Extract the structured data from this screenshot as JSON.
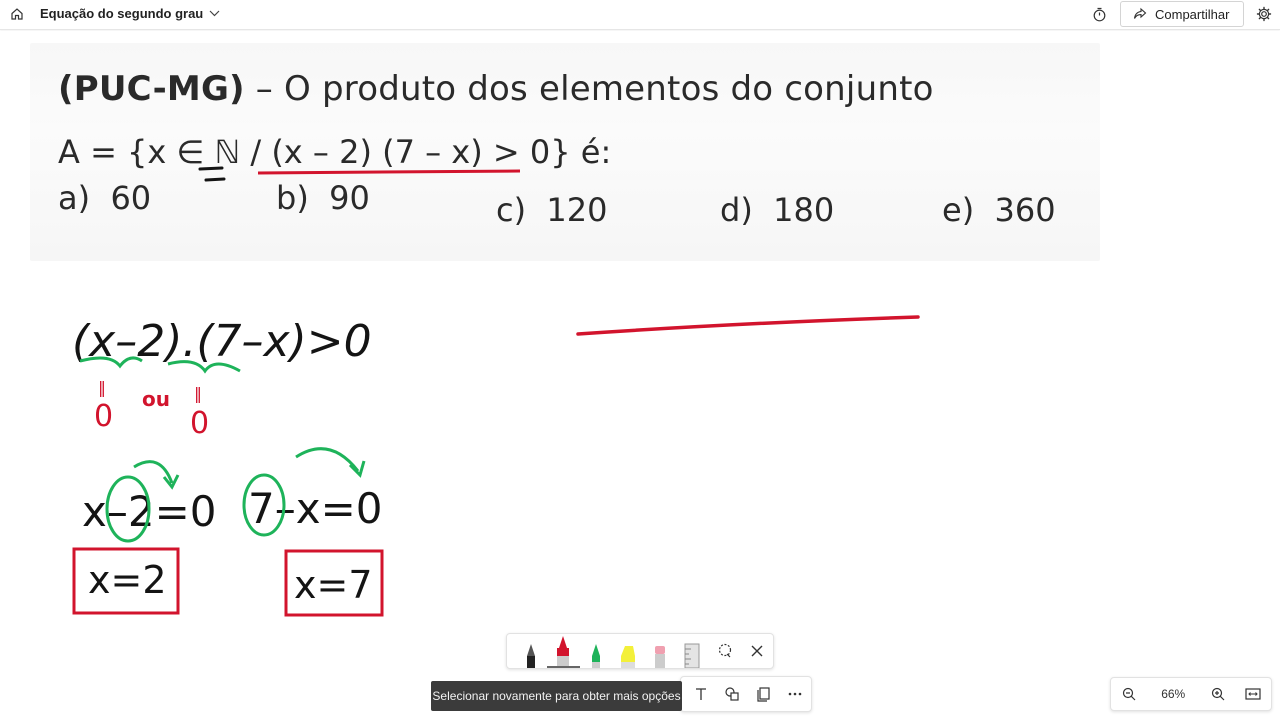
{
  "header": {
    "title": "Equação do segundo grau",
    "share_label": "Compartilhar"
  },
  "problem": {
    "source": "(PUC-MG)",
    "statement": " – O produto dos elementos  do  conjunto",
    "set_definition": "A = {x ∈ ℕ / (x – 2) (7 – x) > 0} é:",
    "options": [
      {
        "letter": "a)",
        "value": "60"
      },
      {
        "letter": "b)",
        "value": "90"
      },
      {
        "letter": "c)",
        "value": "120"
      },
      {
        "letter": "d)",
        "value": "180"
      },
      {
        "letter": "e)",
        "value": "360"
      }
    ]
  },
  "handwriting": {
    "inequality": "(x–2).(7–x)>0",
    "zero_a": "0",
    "zero_b": "0",
    "or_word": "ou",
    "neq": "‖",
    "eq1": "x–2=0",
    "eq2": "7–x=0",
    "sol1": "x=2",
    "sol2": "x=7"
  },
  "tooltip": {
    "text": "Selecionar novamente para obter mais opções"
  },
  "zoom": {
    "level": "66%"
  },
  "colors": {
    "ink_black": "#141414",
    "ink_red": "#d2142d",
    "ink_green": "#1eb35a",
    "tooltip_bg": "#3b3b3b"
  },
  "icons": {
    "home": "home-icon",
    "chevron": "chevron-down-icon",
    "timer": "timer-icon",
    "share": "share-icon",
    "settings": "gear-icon"
  }
}
